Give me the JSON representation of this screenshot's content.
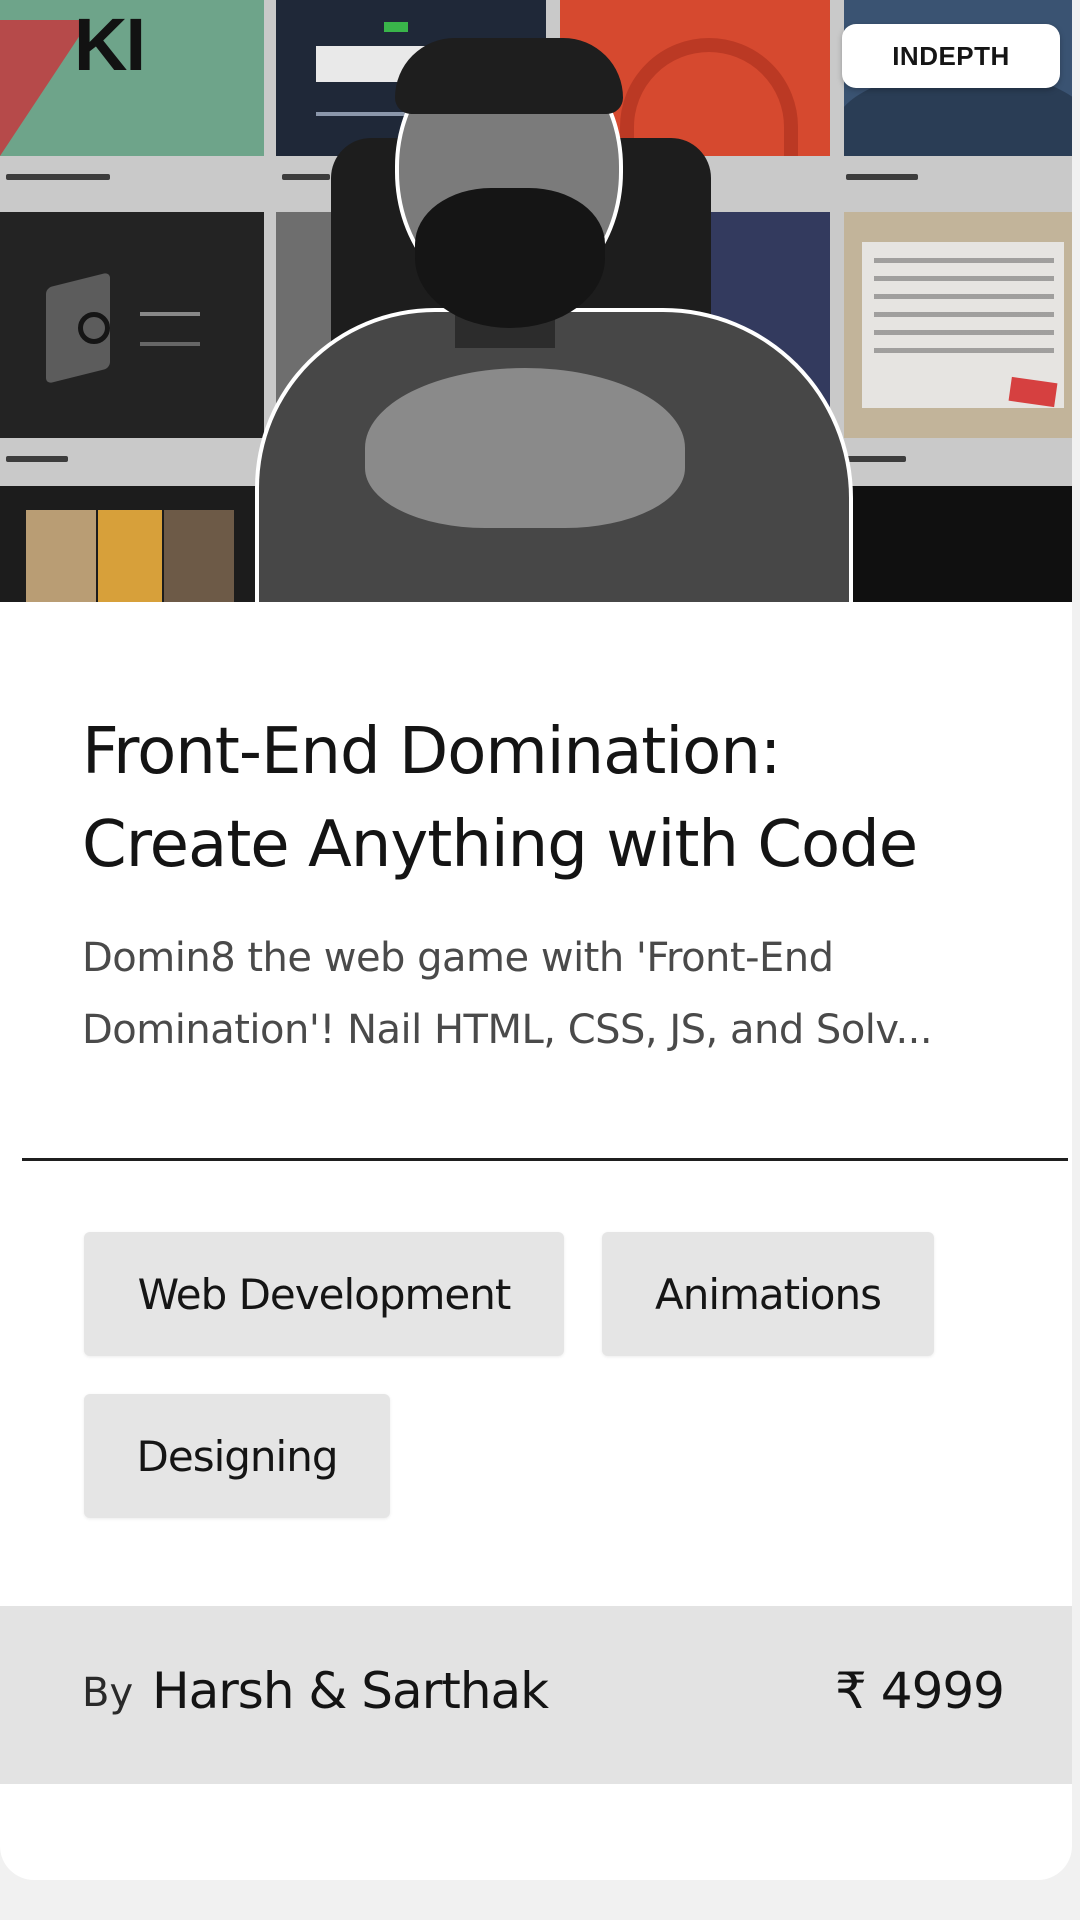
{
  "course": {
    "badge": "INDEPTH",
    "title_line1": "Front-End Domination:",
    "title_line2": "Create Anything with Code",
    "description_line1": "Domin8 the web game with 'Front-End",
    "description_line2": "Domination'! Nail HTML, CSS, JS, and Solv...",
    "tags": [
      "Web Development",
      "Animations",
      "Designing"
    ],
    "by_label": "By",
    "author": "Harsh & Sarthak",
    "price": "₹ 4999"
  },
  "colors": {
    "card_background": "#ffffff",
    "tag_background": "#e5e5e5",
    "footer_background": "#e3e3e3",
    "text": "#141414"
  }
}
